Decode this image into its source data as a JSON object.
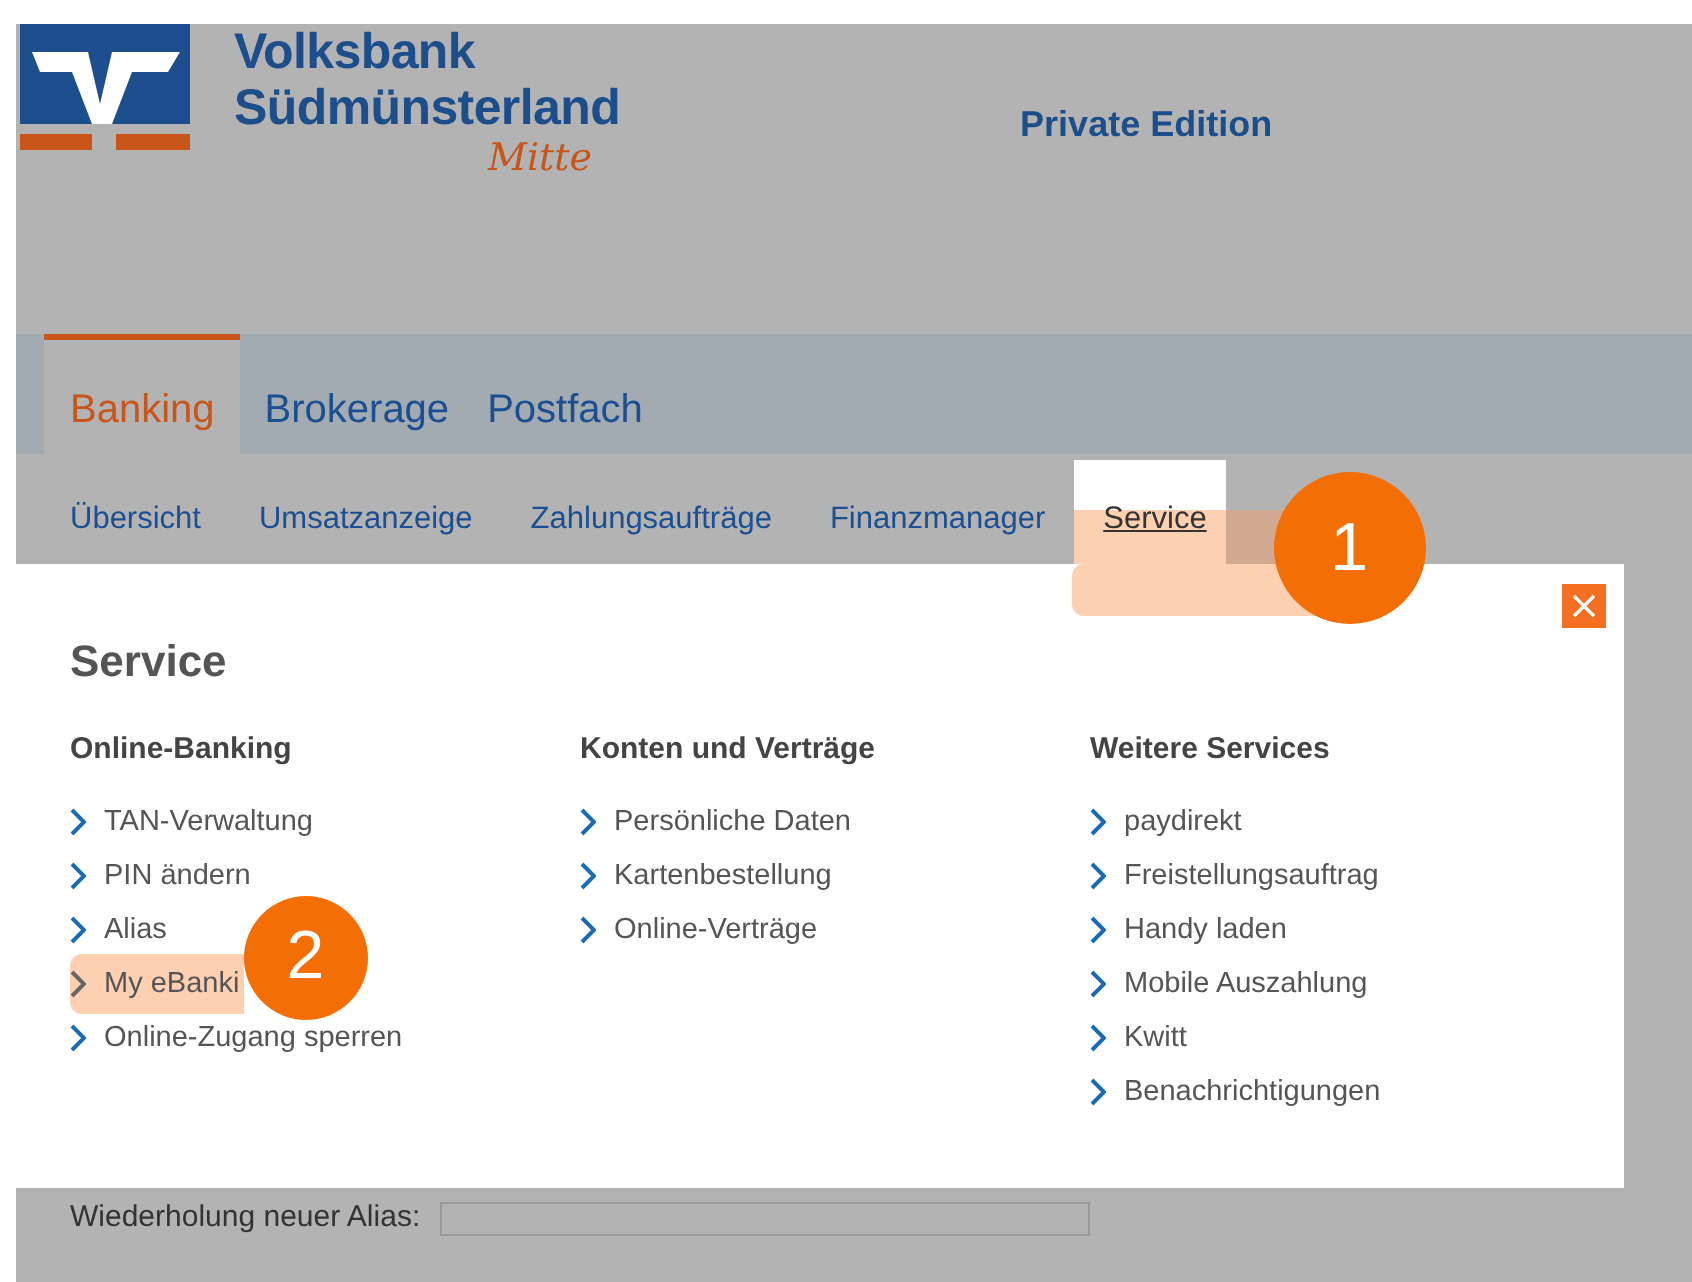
{
  "header": {
    "bank_name": [
      "Volksbank",
      "Südmünsterland"
    ],
    "bank_suffix": "Mitte",
    "edition": "Private Edition"
  },
  "main_tabs": [
    {
      "label": "Banking",
      "selected": true
    },
    {
      "label": "Brokerage",
      "selected": false
    },
    {
      "label": "Postfach",
      "selected": false
    }
  ],
  "sub_tabs": [
    {
      "label": "Übersicht",
      "selected": false,
      "highlighted": false
    },
    {
      "label": "Umsatzanzeige",
      "selected": false,
      "highlighted": false
    },
    {
      "label": "Zahlungsaufträge",
      "selected": false,
      "highlighted": false
    },
    {
      "label": "Finanzmanager",
      "selected": false,
      "highlighted": false
    },
    {
      "label": "Service",
      "selected": true,
      "highlighted": true,
      "annotation": "1"
    }
  ],
  "service_panel": {
    "title": "Service",
    "columns": [
      {
        "heading": "Online-Banking",
        "items": [
          {
            "label": "TAN-Verwaltung",
            "highlighted": false
          },
          {
            "label": "PIN ändern",
            "highlighted": false
          },
          {
            "label": "Alias",
            "highlighted": false
          },
          {
            "label": "My eBanki",
            "highlighted": true,
            "annotation": "2"
          },
          {
            "label": "Online-Zugang sperren",
            "highlighted": false
          }
        ]
      },
      {
        "heading": "Konten und Verträge",
        "items": [
          {
            "label": "Persönliche Daten",
            "highlighted": false
          },
          {
            "label": "Kartenbestellung",
            "highlighted": false
          },
          {
            "label": "Online-Verträge",
            "highlighted": false
          }
        ]
      },
      {
        "heading": "Weitere Services",
        "items": [
          {
            "label": "paydirekt",
            "highlighted": false
          },
          {
            "label": "Freistellungsauftrag",
            "highlighted": false
          },
          {
            "label": "Handy laden",
            "highlighted": false
          },
          {
            "label": "Mobile Auszahlung",
            "highlighted": false
          },
          {
            "label": "Kwitt",
            "highlighted": false
          },
          {
            "label": "Benachrichtigungen",
            "highlighted": false
          }
        ]
      }
    ]
  },
  "form": {
    "label": "Wiederholung neuer Alias:"
  }
}
